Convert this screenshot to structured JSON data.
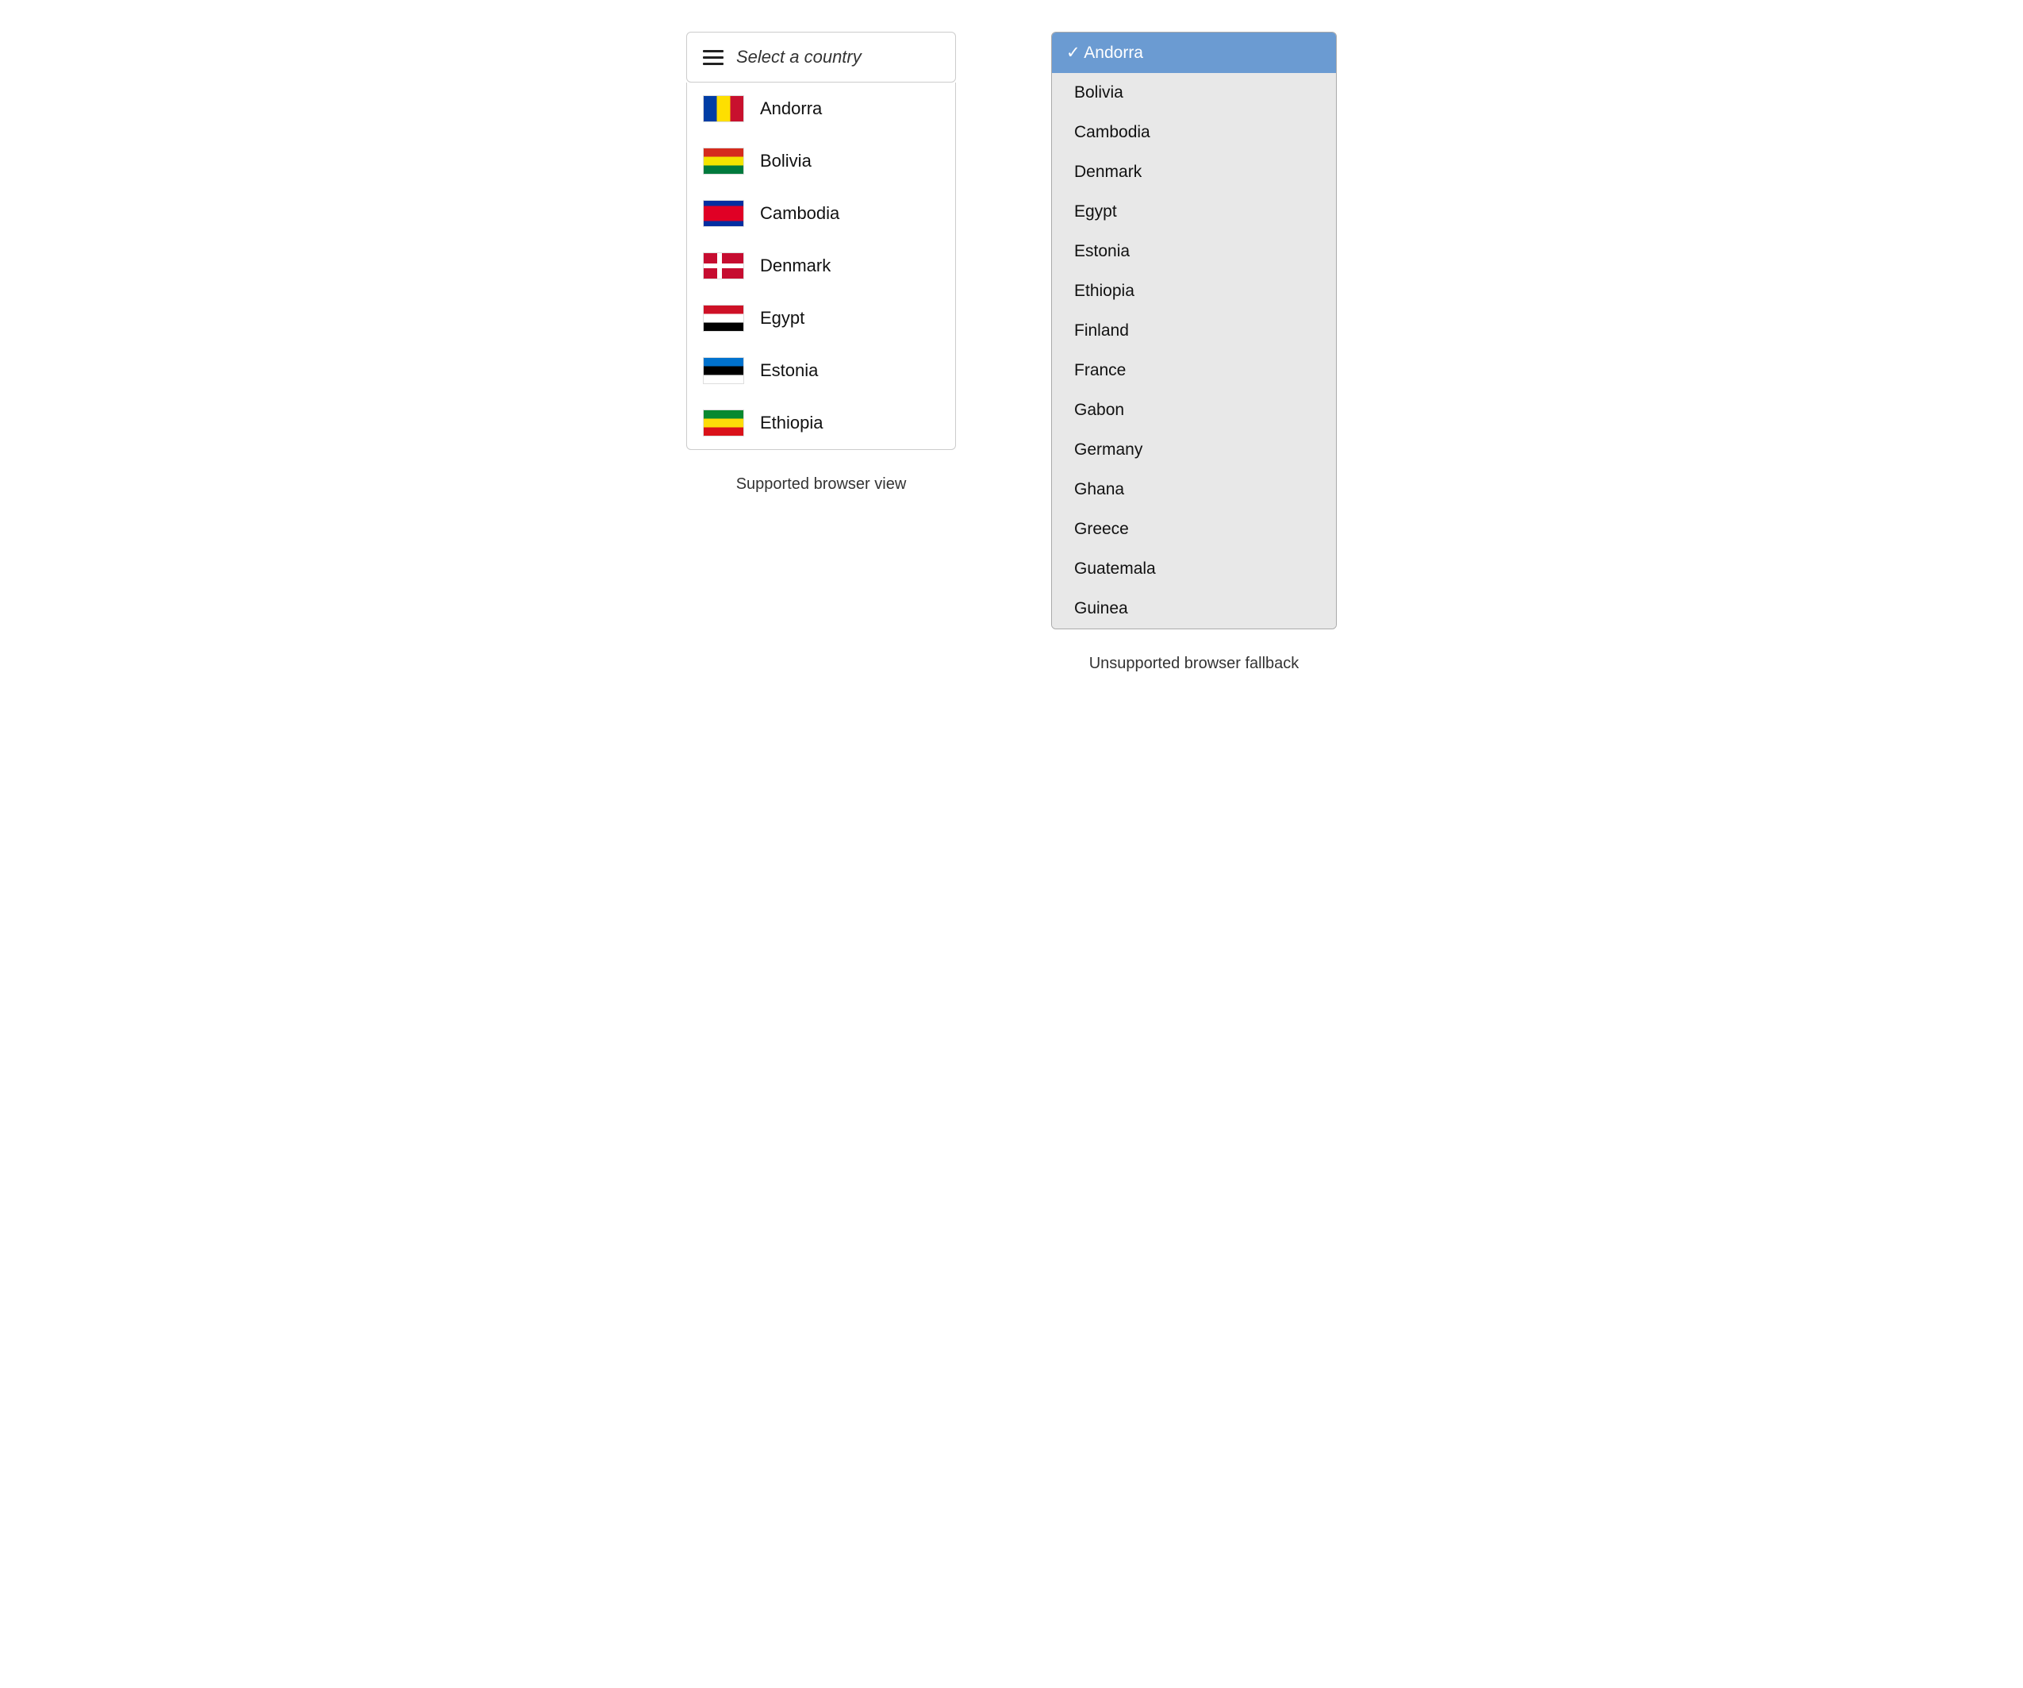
{
  "left": {
    "trigger": {
      "icon": "hamburger-icon",
      "label": "Select a country"
    },
    "countries": [
      {
        "id": "andorra",
        "name": "Andorra",
        "flagClass": "flag-andorra"
      },
      {
        "id": "bolivia",
        "name": "Bolivia",
        "flagClass": "flag-bolivia"
      },
      {
        "id": "cambodia",
        "name": "Cambodia",
        "flagClass": "flag-cambodia"
      },
      {
        "id": "denmark",
        "name": "Denmark",
        "flagClass": "flag-denmark"
      },
      {
        "id": "egypt",
        "name": "Egypt",
        "flagClass": "flag-egypt"
      },
      {
        "id": "estonia",
        "name": "Estonia",
        "flagClass": "flag-estonia"
      },
      {
        "id": "ethiopia",
        "name": "Ethiopia",
        "flagClass": "flag-ethiopia"
      }
    ],
    "panelLabel": "Supported browser view"
  },
  "right": {
    "countries": [
      {
        "id": "andorra",
        "name": "Andorra",
        "selected": true
      },
      {
        "id": "bolivia",
        "name": "Bolivia",
        "selected": false
      },
      {
        "id": "cambodia",
        "name": "Cambodia",
        "selected": false
      },
      {
        "id": "denmark",
        "name": "Denmark",
        "selected": false
      },
      {
        "id": "egypt",
        "name": "Egypt",
        "selected": false
      },
      {
        "id": "estonia",
        "name": "Estonia",
        "selected": false
      },
      {
        "id": "ethiopia",
        "name": "Ethiopia",
        "selected": false
      },
      {
        "id": "finland",
        "name": "Finland",
        "selected": false
      },
      {
        "id": "france",
        "name": "France",
        "selected": false
      },
      {
        "id": "gabon",
        "name": "Gabon",
        "selected": false
      },
      {
        "id": "germany",
        "name": "Germany",
        "selected": false
      },
      {
        "id": "ghana",
        "name": "Ghana",
        "selected": false
      },
      {
        "id": "greece",
        "name": "Greece",
        "selected": false
      },
      {
        "id": "guatemala",
        "name": "Guatemala",
        "selected": false
      },
      {
        "id": "guinea",
        "name": "Guinea",
        "selected": false
      }
    ],
    "panelLabel": "Unsupported browser fallback"
  }
}
